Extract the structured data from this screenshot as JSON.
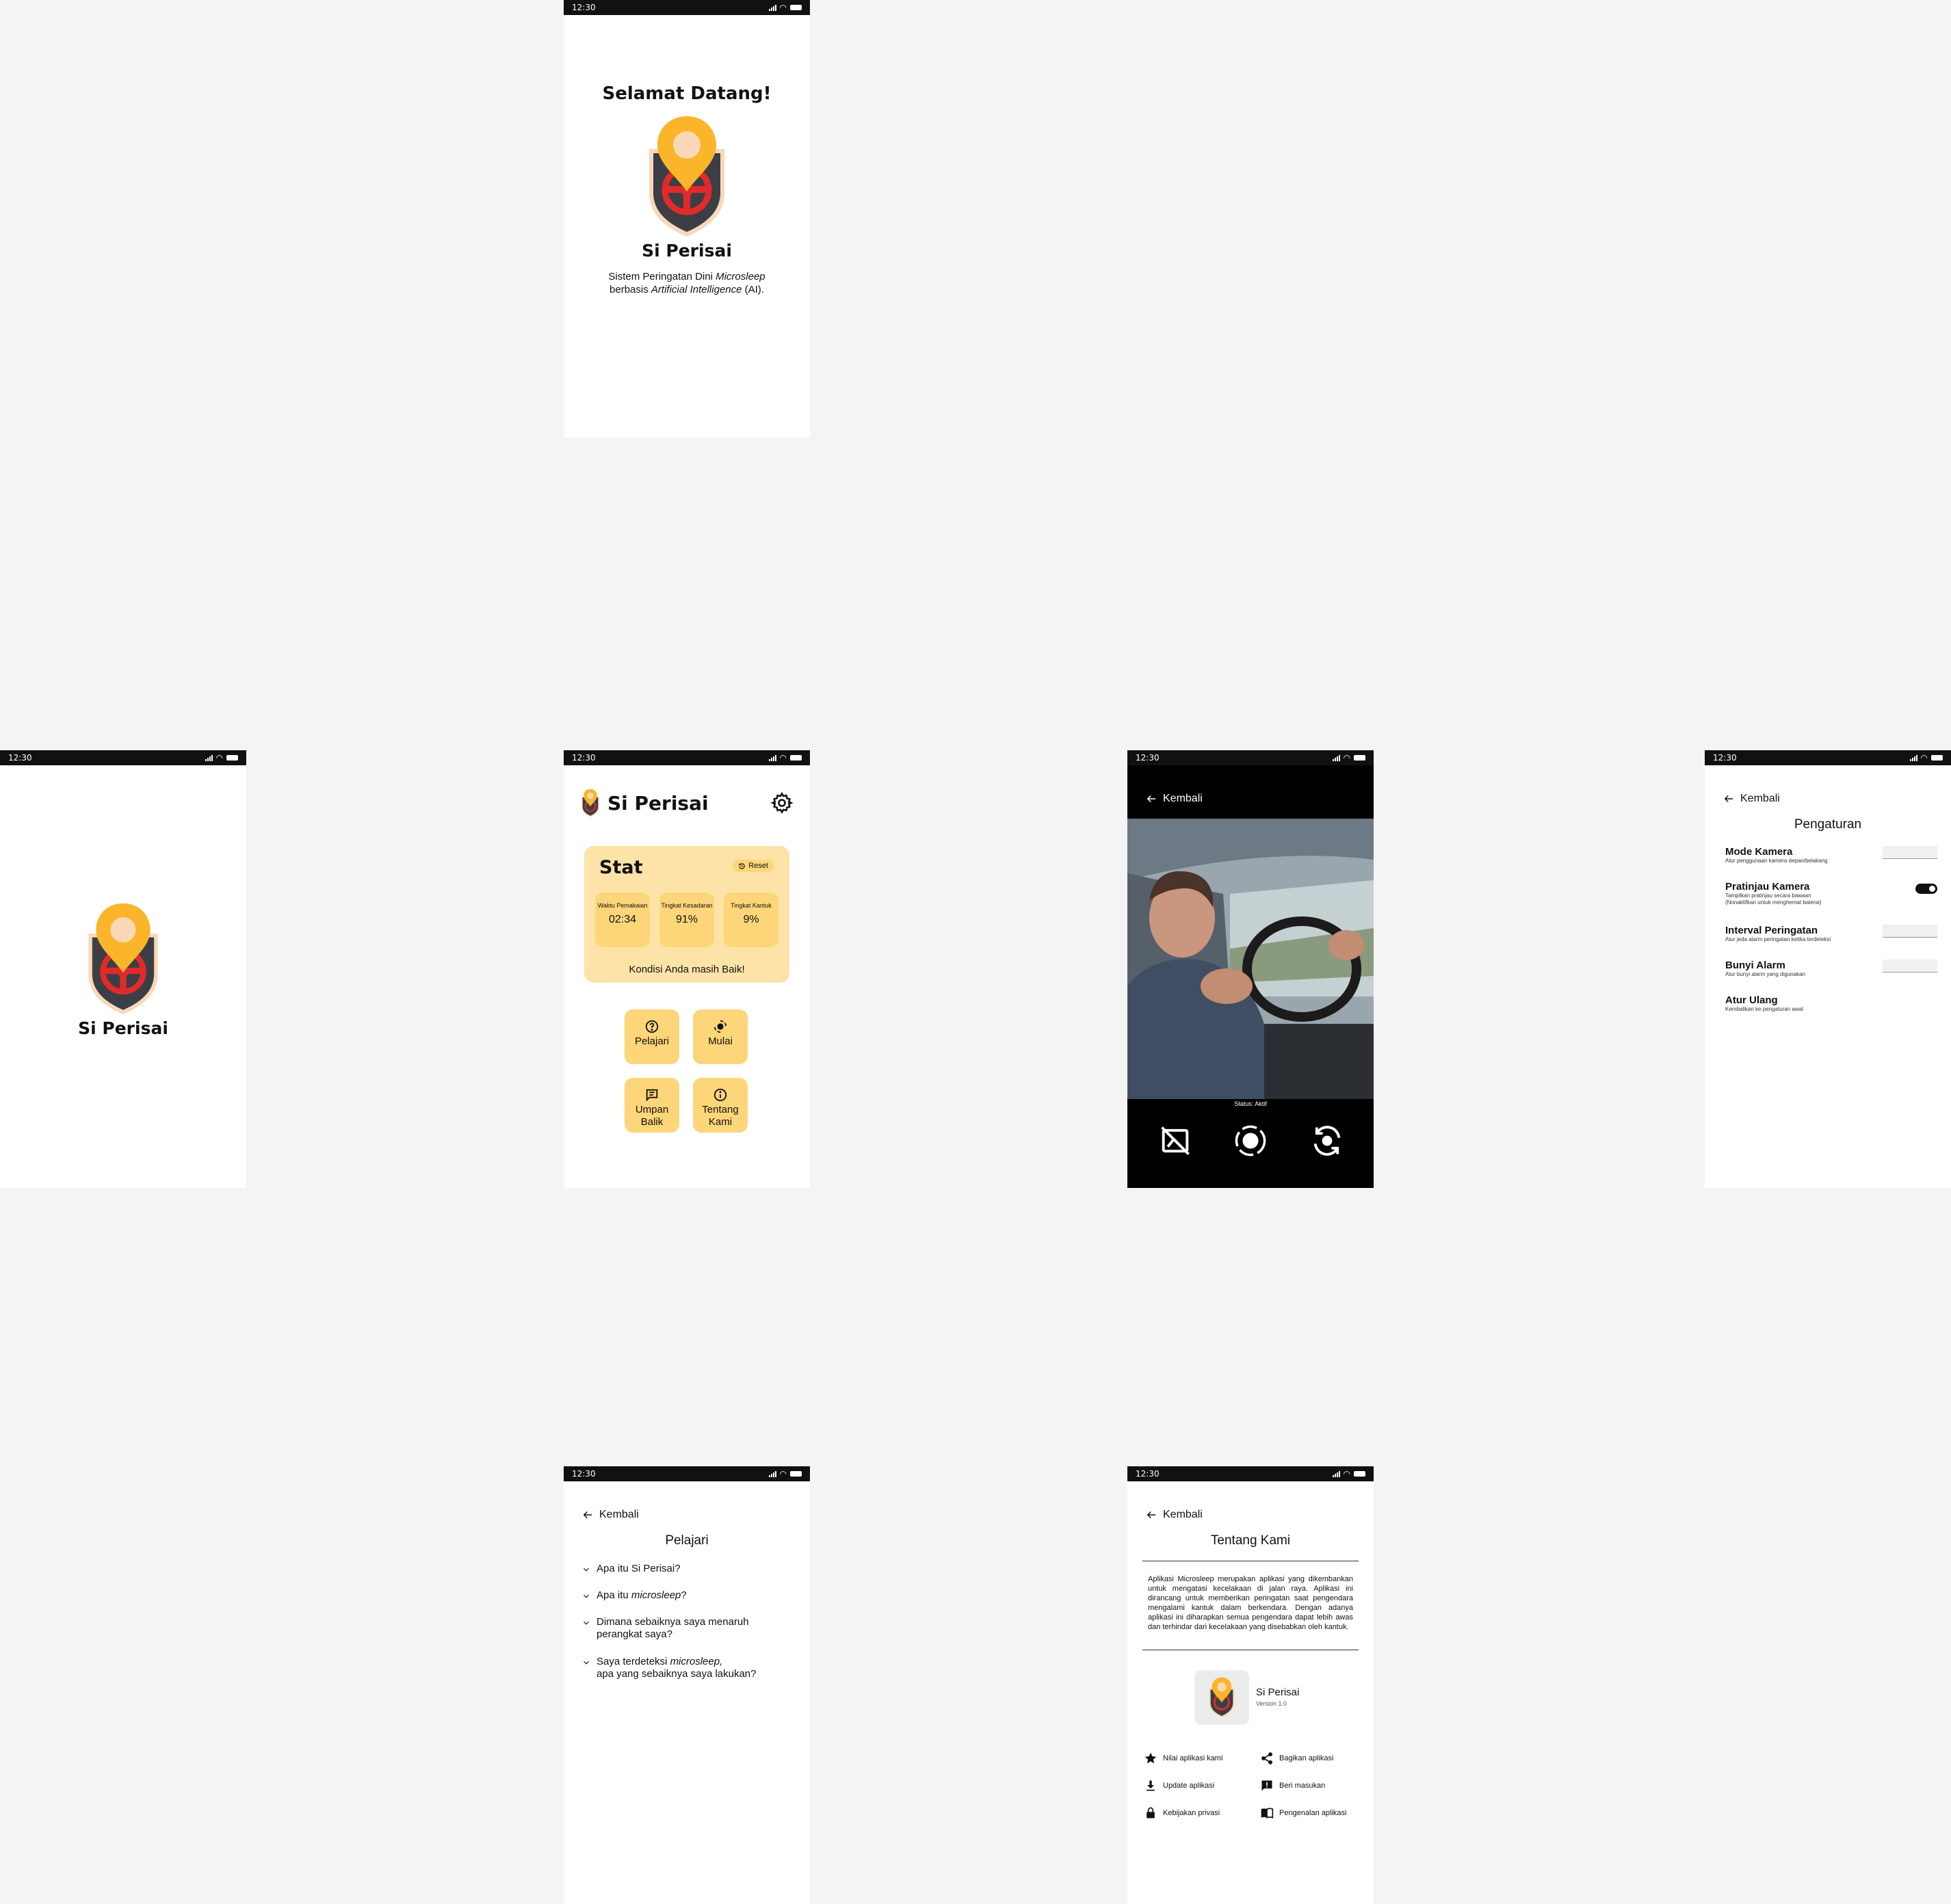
{
  "status_time": "12:30",
  "colors": {
    "accent": "#fcd679",
    "accent_light": "#fde3a7",
    "dark": "#111111",
    "shield": "#3b3f45",
    "pin": "#fbb52b",
    "wheel": "#e32a2a"
  },
  "welcome": {
    "title": "Selamat Datang!",
    "brand": "Si Perisai",
    "desc_1a": "Sistem Peringatan Dini ",
    "desc_1b": "Microsleep",
    "desc_2a": "berbasis ",
    "desc_2b": "Artificial Intelligence",
    "desc_2c": " (AI)."
  },
  "splash": {
    "brand": "Si Perisai"
  },
  "home": {
    "brand": "Si Perisai",
    "stat_title": "Stat",
    "reset_label": "Reset",
    "stats": [
      {
        "label": "Waktu Pemakaian",
        "value": "02:34"
      },
      {
        "label": "Tingkat Kesadaran",
        "value": "91%"
      },
      {
        "label": "Tingkat Kantuk",
        "value": "9%"
      }
    ],
    "condition": "Kondisi Anda masih Baik!",
    "tiles": [
      {
        "label": "Pelajari",
        "icon": "help-circle-icon"
      },
      {
        "label": "Mulai",
        "icon": "record-icon"
      },
      {
        "label": "Umpan Balik",
        "icon": "feedback-icon"
      },
      {
        "label": "Tentang Kami",
        "icon": "info-icon"
      }
    ]
  },
  "camera": {
    "back_label": "Kembali",
    "status": "Status: Aktif"
  },
  "settings": {
    "back_label": "Kembali",
    "title": "Pengaturan",
    "items": [
      {
        "name": "Mode Kamera",
        "sub": "Atur penggunaan kamera depan/belakang"
      },
      {
        "name": "Pratinjau Kamera",
        "sub": "Tampilkan pratinjau secara bawaan",
        "sub2": "(Nonaktifkan untuk menghemat baterai)",
        "toggle": true
      },
      {
        "name": "Interval Peringatan",
        "sub": "Atur jeda alarm peringatan ketika terdeteksi"
      },
      {
        "name": "Bunyi Alarm",
        "sub": "Atur bunyi alarm yang digunakan"
      },
      {
        "name": "Atur Ulang",
        "sub": "Kembalikan ke pengaturan awal"
      }
    ]
  },
  "learn": {
    "back_label": "Kembali",
    "title": "Pelajari",
    "q1": "Apa itu Si Perisai?",
    "q2a": "Apa itu ",
    "q2b": "microsleep",
    "q2c": "?",
    "q3": "Dimana sebaiknya saya menaruh perangkat saya?",
    "q4a": "Saya terdeteksi ",
    "q4b": "microsleep,",
    "q4c": "apa yang sebaiknya saya lakukan?"
  },
  "about": {
    "back_label": "Kembali",
    "title": "Tentang Kami",
    "text": "Aplikasi Microsleep merupakan aplikasi yang dikembankan untuk mengatasi kecelakaan di jalan raya. Aplikasi ini dirancang untuk memberikan peringatan saat pengendara mengalami kantuk dalam berkendara. Dengan adanya aplikasi ini diharapkan semua pengendara dapat lebih awas dan terhindar dari kecelakaan yang disebabkan oleh kantuk.",
    "app_name": "Si Perisai",
    "version": "Version 1.0",
    "actions": [
      {
        "label": "Nilai aplikasi kami",
        "icon": "star-icon"
      },
      {
        "label": "Bagikan aplikasi",
        "icon": "share-icon"
      },
      {
        "label": "Update aplikasi",
        "icon": "download-icon"
      },
      {
        "label": "Beri masukan",
        "icon": "feedback-icon"
      },
      {
        "label": "Kebijakan privasi",
        "icon": "lock-icon"
      },
      {
        "label": "Pengenalan aplikasi",
        "icon": "book-icon"
      }
    ]
  }
}
